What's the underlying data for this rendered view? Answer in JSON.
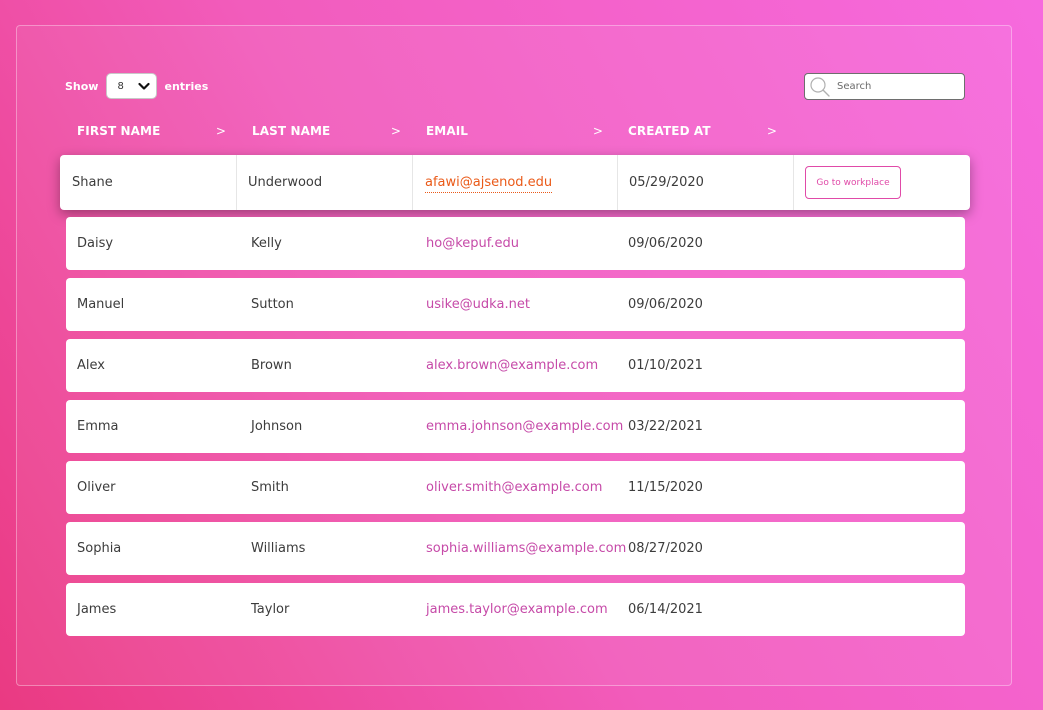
{
  "controls": {
    "show_label": "Show",
    "page_size": "8",
    "entries_label": "entries",
    "search_placeholder": "Search"
  },
  "table": {
    "columns": [
      {
        "label": "FIRST NAME",
        "sort_icon": ">"
      },
      {
        "label": "LAST NAME",
        "sort_icon": ">"
      },
      {
        "label": "EMAIL",
        "sort_icon": ">"
      },
      {
        "label": "CREATED AT",
        "sort_icon": ">"
      }
    ],
    "rows": [
      {
        "first": "Shane",
        "last": "Underwood",
        "email": "afawi@ajsenod.edu",
        "created": "05/29/2020",
        "action": "Go to workplace"
      },
      {
        "first": "Daisy",
        "last": "Kelly",
        "email": "ho@kepuf.edu",
        "created": "09/06/2020"
      },
      {
        "first": "Manuel",
        "last": "Sutton",
        "email": "usike@udka.net",
        "created": "09/06/2020"
      },
      {
        "first": "Alex",
        "last": "Brown",
        "email": "alex.brown@example.com",
        "created": "01/10/2021"
      },
      {
        "first": "Emma",
        "last": "Johnson",
        "email": "emma.johnson@example.com",
        "created": "03/22/2021"
      },
      {
        "first": "Oliver",
        "last": "Smith",
        "email": "oliver.smith@example.com",
        "created": "11/15/2020"
      },
      {
        "first": "Sophia",
        "last": "Williams",
        "email": "sophia.williams@example.com",
        "created": "08/27/2020"
      },
      {
        "first": "James",
        "last": "Taylor",
        "email": "james.taylor@example.com",
        "created": "06/14/2021"
      }
    ]
  },
  "icons": {
    "dropdown": "chevron-down-icon",
    "search": "search-icon"
  },
  "colors": {
    "background_start": "#ea3a82",
    "background_end": "#f66ade",
    "email_link": "#c64aa8",
    "active_email": "#ea5a18",
    "button_accent": "#e04aa8"
  }
}
